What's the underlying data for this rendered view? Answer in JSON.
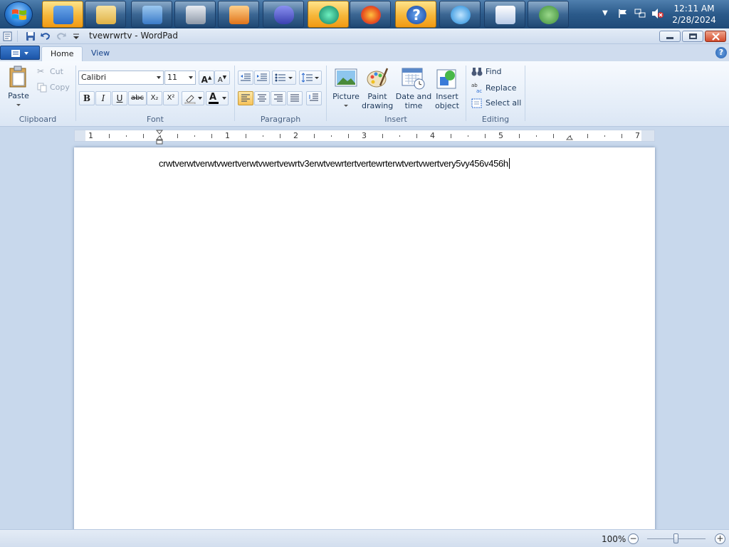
{
  "taskbar": {
    "start_label": "Start",
    "apps": [
      {
        "name": "control-panel-icon",
        "color": "#2c6cc4"
      },
      {
        "name": "windows-explorer-icon",
        "color": "#e8c25a"
      },
      {
        "name": "remote-desktop-icon",
        "color": "#3a8ad8"
      },
      {
        "name": "calculator-icon",
        "color": "#8e99a8"
      },
      {
        "name": "media-player-icon",
        "color": "#e58a2a"
      },
      {
        "name": "infinity-app-icon",
        "color": "#4a55c8"
      },
      {
        "name": "green-orb-app-icon",
        "color": "#1aa080"
      },
      {
        "name": "firefox-icon",
        "color": "#e8501c"
      },
      {
        "name": "help-icon",
        "color": "#1a5fd0"
      },
      {
        "name": "internet-explorer-icon",
        "color": "#1e88d8"
      },
      {
        "name": "wordpad-icon",
        "color": "#4a7cc8"
      },
      {
        "name": "windows-logo-icon",
        "color": "#3e8e3a"
      }
    ],
    "clock_time": "12:11 AM",
    "clock_date": "2/28/2024"
  },
  "window": {
    "title": "tvewrwrtv - WordPad"
  },
  "tabs": {
    "home": "Home",
    "view": "View"
  },
  "help_label": "?",
  "ribbon": {
    "clipboard": {
      "paste": "Paste",
      "cut": "Cut",
      "copy": "Copy",
      "label": "Clipboard"
    },
    "font": {
      "family": "Calibri",
      "size": "11",
      "bold": "B",
      "italic": "I",
      "underline": "U",
      "strike": "abc",
      "subscript": "X₂",
      "superscript": "X²",
      "label": "Font"
    },
    "paragraph": {
      "label": "Paragraph"
    },
    "insert": {
      "picture": "Picture",
      "paint_line1": "Paint",
      "paint_line2": "drawing",
      "datetime_line1": "Date and",
      "datetime_line2": "time",
      "object_line1": "Insert",
      "object_line2": "object",
      "label": "Insert"
    },
    "editing": {
      "find": "Find",
      "replace": "Replace",
      "select_all": "Select all",
      "label": "Editing"
    }
  },
  "ruler": {
    "numbers": [
      "1",
      "1",
      "2",
      "3",
      "4",
      "5",
      "7"
    ]
  },
  "document": {
    "text": "crwtverwtverwtvwertverwtvwertvewrtv3erwtvewrtertvertewrterwtvertvwertvery5vy456v456h"
  },
  "status": {
    "zoom": "100%",
    "zoom_level": 1.0
  }
}
